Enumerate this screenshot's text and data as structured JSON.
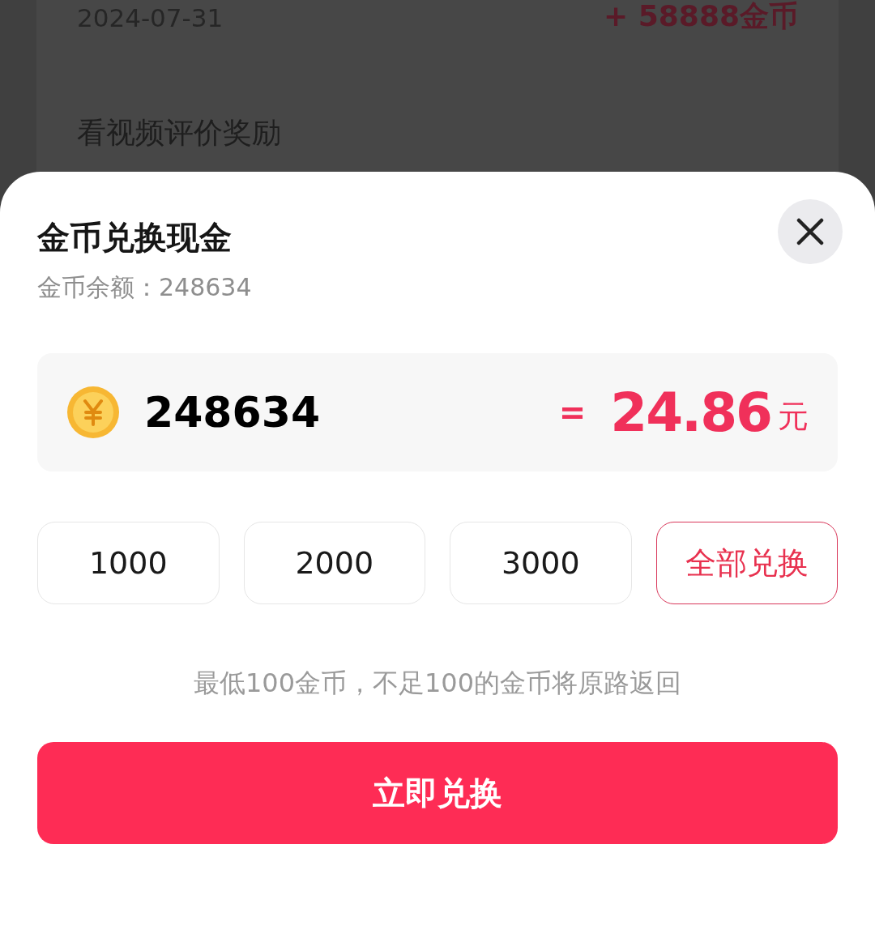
{
  "background_list": {
    "items": [
      {
        "date": "2024-07-31",
        "amount": "+ 58888金币"
      },
      {
        "title": "看视频评价奖励"
      }
    ]
  },
  "sheet": {
    "title": "金币兑换现金",
    "balance_label": "金币余额：248634",
    "coins": "248634",
    "equals": "=",
    "cash": "24.86",
    "unit": "元",
    "options": [
      {
        "label": "1000",
        "selected": false
      },
      {
        "label": "2000",
        "selected": false
      },
      {
        "label": "3000",
        "selected": false
      },
      {
        "label": "全部兑换",
        "selected": true
      }
    ],
    "note": "最低100金币，不足100的金币将原路返回",
    "button": "立即兑换"
  }
}
